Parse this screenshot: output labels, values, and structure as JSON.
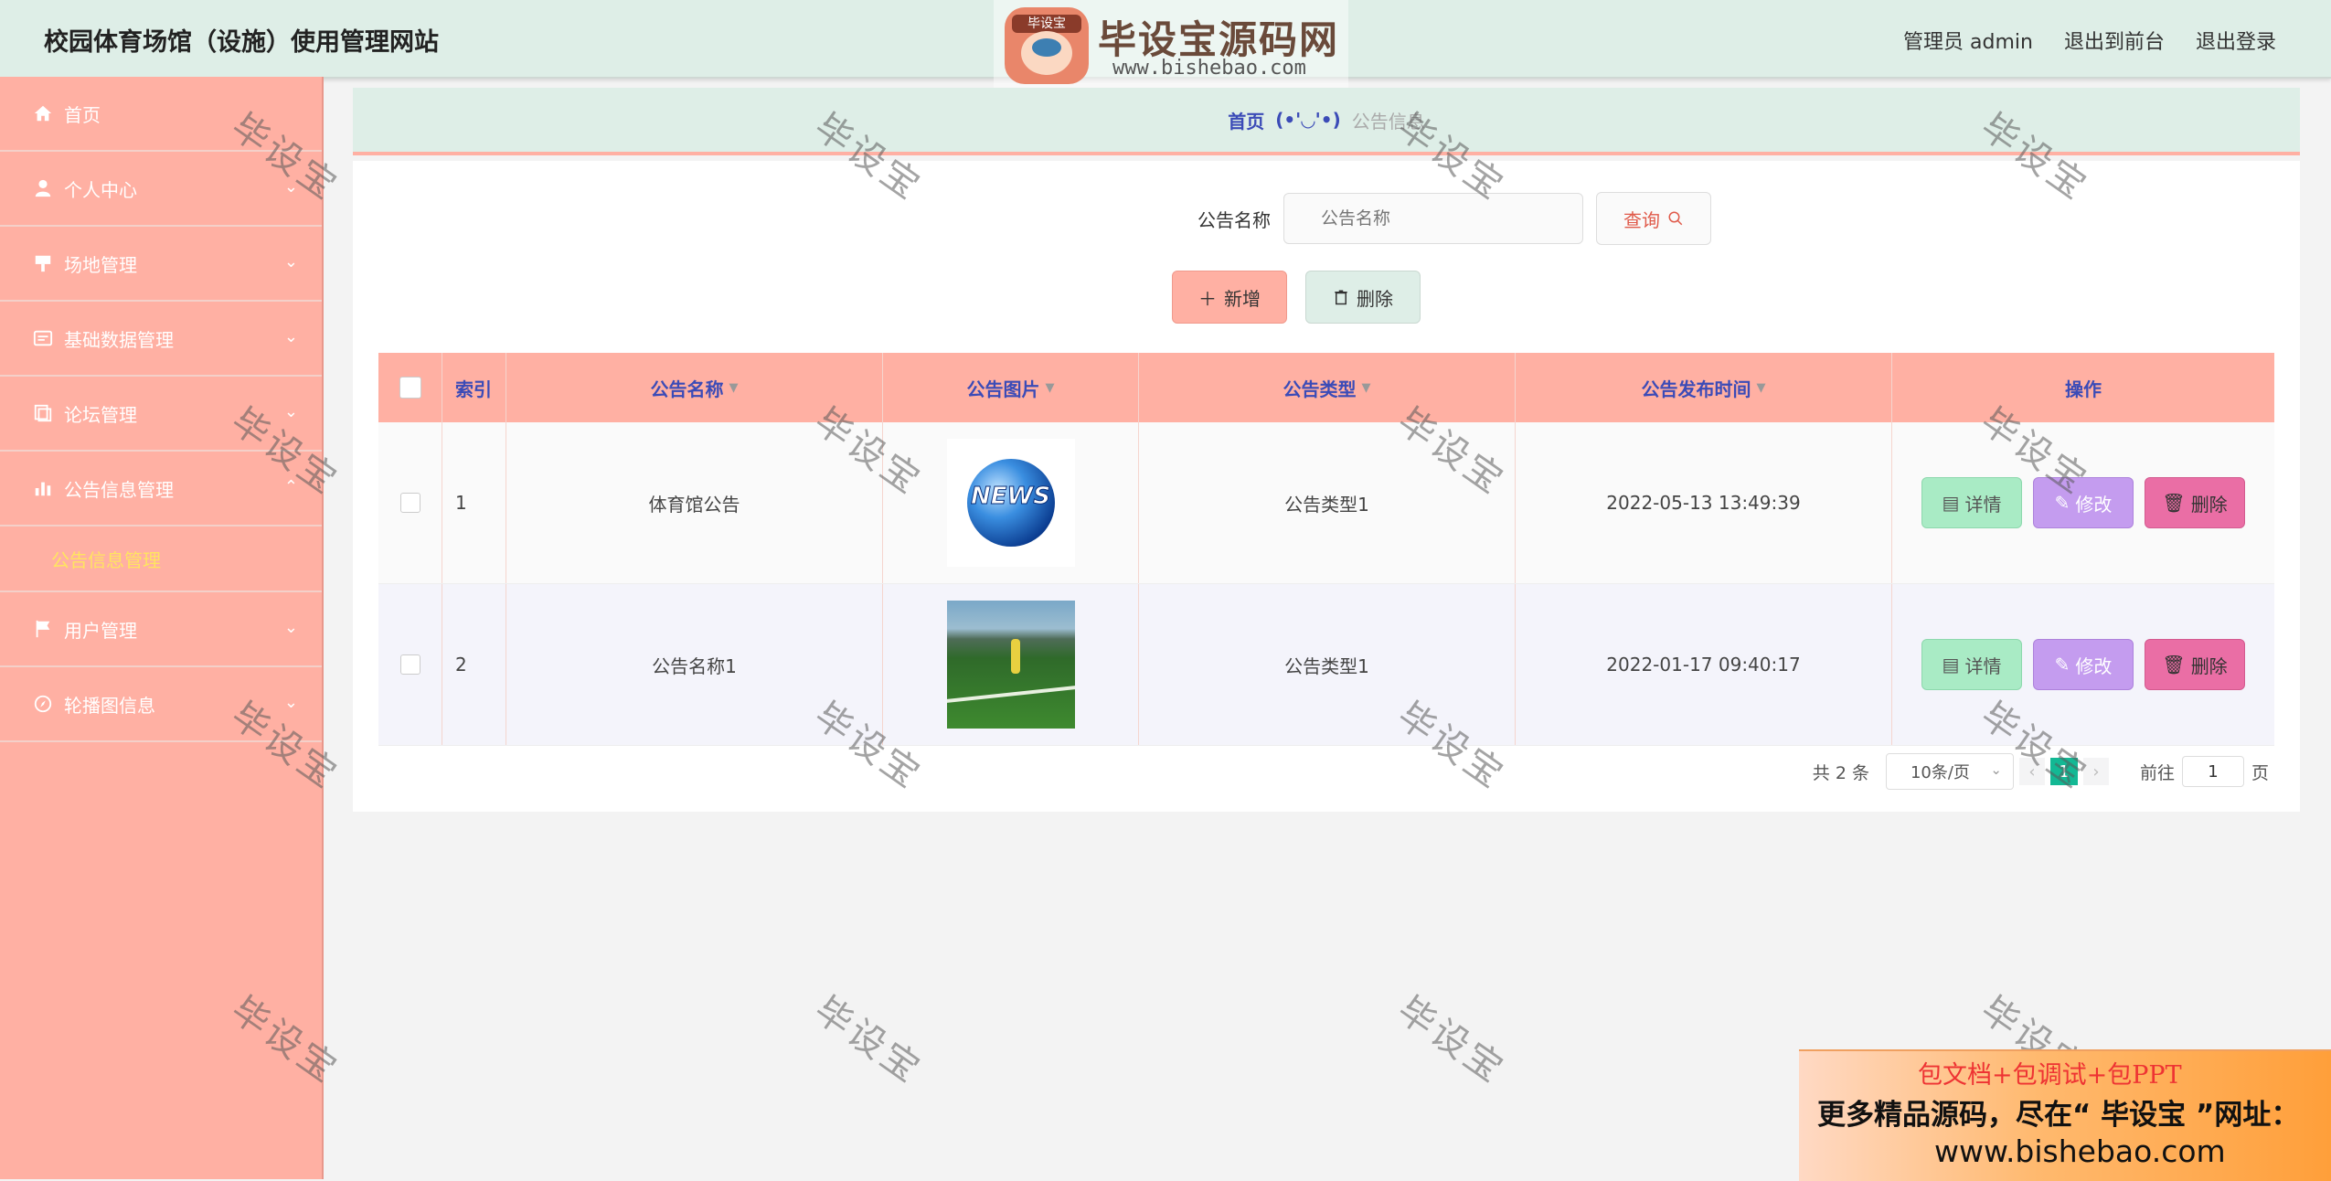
{
  "app": {
    "title": "校园体育场馆（设施）使用管理网站",
    "brand_name": "毕设宝源码网",
    "brand_badge": "毕设宝",
    "brand_url": "www.bishebao.com"
  },
  "header": {
    "user_label": "管理员 admin",
    "back_to_front": "退出到前台",
    "logout": "退出登录"
  },
  "sidebar": {
    "items": [
      {
        "label": "首页",
        "icon": "home-icon",
        "has_children": false
      },
      {
        "label": "个人中心",
        "icon": "user-icon",
        "has_children": true
      },
      {
        "label": "场地管理",
        "icon": "venue-icon",
        "has_children": true
      },
      {
        "label": "基础数据管理",
        "icon": "data-icon",
        "has_children": true
      },
      {
        "label": "论坛管理",
        "icon": "forum-icon",
        "has_children": true
      },
      {
        "label": "公告信息管理",
        "icon": "chart-icon",
        "has_children": true,
        "expanded": true
      },
      {
        "label": "用户管理",
        "icon": "flag-icon",
        "has_children": true
      },
      {
        "label": "轮播图信息",
        "icon": "compass-icon",
        "has_children": true
      }
    ],
    "sub_active": "公告信息管理"
  },
  "breadcrumb": {
    "home": "首页",
    "emote": "(•'◡'•)",
    "current": "公告信息"
  },
  "search": {
    "label": "公告名称",
    "placeholder": "公告名称",
    "button": "查询"
  },
  "actions": {
    "add": "新增",
    "delete": "删除"
  },
  "table": {
    "headers": [
      "索引",
      "公告名称",
      "公告图片",
      "公告类型",
      "公告发布时间",
      "操作"
    ],
    "rows": [
      {
        "index": "1",
        "name": "体育馆公告",
        "image": "news-globe",
        "type": "公告类型1",
        "time": "2022-05-13 13:49:39"
      },
      {
        "index": "2",
        "name": "公告名称1",
        "image": "soccer-field",
        "type": "公告类型1",
        "time": "2022-01-17 09:40:17"
      }
    ],
    "row_actions": {
      "detail": "详情",
      "edit": "修改",
      "remove": "删除"
    },
    "news_text": "NEWS"
  },
  "pagination": {
    "total": "共 2 条",
    "page_size": "10条/页",
    "current_page": "1",
    "goto_prefix": "前往",
    "goto_value": "1",
    "goto_suffix": "页"
  },
  "watermark": "毕设宝",
  "promo": {
    "line1": "包文档+包调试+包PPT",
    "line2": "更多精品源码，尽在“ 毕设宝 ”网址：",
    "line3": "www.bishebao.com"
  },
  "colors": {
    "accent": "#ffb0a3",
    "header_bg": "#deeee7",
    "link_blue": "#3b4bb7",
    "active_sub": "#ffe560",
    "page_active": "#13b894"
  }
}
